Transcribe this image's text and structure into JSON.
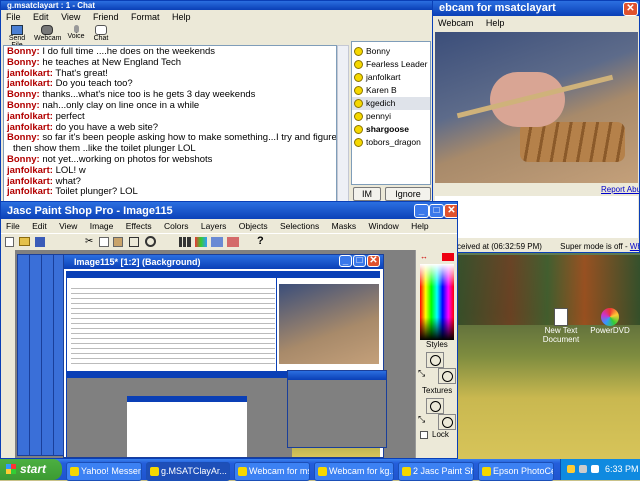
{
  "chat_window": {
    "title": "g.msatclayart : 1 - Chat",
    "menu": [
      "File",
      "Edit",
      "View",
      "Friend",
      "Format",
      "Help"
    ],
    "toolbar": [
      "Send File",
      "Webcam",
      "Voice",
      "Chat"
    ],
    "messages": [
      {
        "name": "Bonny:",
        "text": "I do full time ....he does on the weekends"
      },
      {
        "name": "Bonny:",
        "text": "he teaches at New England Tech"
      },
      {
        "name": "janfolkart:",
        "text": "That's great!"
      },
      {
        "name": "janfolkart:",
        "text": "Do you teach too?"
      },
      {
        "name": "Bonny:",
        "text": "thanks...what's nice too is he gets 3 day weekends"
      },
      {
        "name": "Bonny:",
        "text": "nah...only clay on line once in a while"
      },
      {
        "name": "janfolkart:",
        "text": "perfect"
      },
      {
        "name": "janfolkart:",
        "text": "do you have a web site?"
      },
      {
        "name": "Bonny:",
        "text": "so far it's been people asking how to make something...I try and figure it out and"
      },
      {
        "name": "",
        "text": "then show them ..like the toilet plunger LOL"
      },
      {
        "name": "Bonny:",
        "text": "not yet...working on photos for webshots"
      },
      {
        "name": "janfolkart:",
        "text": "LOL! w"
      },
      {
        "name": "janfolkart:",
        "text": "what?"
      },
      {
        "name": "janfolkart:",
        "text": "Toilet plunger? LOL"
      }
    ],
    "users": [
      "Bonny",
      "Fearless Leader",
      "janfolkart",
      "Karen B",
      "kgedich",
      "pennyi",
      "shargoose",
      "tobors_dragon"
    ],
    "im_button": "IM",
    "ignore_button": "Ignore User"
  },
  "webcam_window": {
    "title": "ebcam for msatclayart",
    "menu": [
      "Webcam",
      "Help"
    ],
    "report_abuse": "Report Abuse",
    "received": "ceived at (06:32:59 PM)",
    "super_mode": "Super mode is off -",
    "whats_this": "What's this?"
  },
  "desktop": {
    "icons": [
      {
        "label": "New Text Document",
        "icon": "text-document-icon"
      },
      {
        "label": "PowerDVD",
        "icon": "powerdvd-icon"
      }
    ]
  },
  "psp_window": {
    "title": "Jasc Paint Shop Pro - Image115",
    "menu": [
      "File",
      "Edit",
      "View",
      "Image",
      "Effects",
      "Colors",
      "Layers",
      "Objects",
      "Selections",
      "Masks",
      "Window",
      "Help"
    ],
    "image_title": "Image115* [1:2] (Background)",
    "palette": {
      "styles": "Styles",
      "textures": "Textures",
      "lock": "Lock"
    }
  },
  "taskbar": {
    "start": "start",
    "buttons": [
      "Yahoo! Messen...",
      "g.MSATClayAr...",
      "Webcam for ms...",
      "Webcam for kg...",
      "2 Jasc Paint Shop...",
      "Epson PhotoCe..."
    ],
    "clock": "6:33 PM"
  },
  "colors": {
    "xp_blue": "#0a3fb6",
    "chat_name": "#b20000",
    "taskbar": "#245edb",
    "start": "#3c9a32"
  }
}
